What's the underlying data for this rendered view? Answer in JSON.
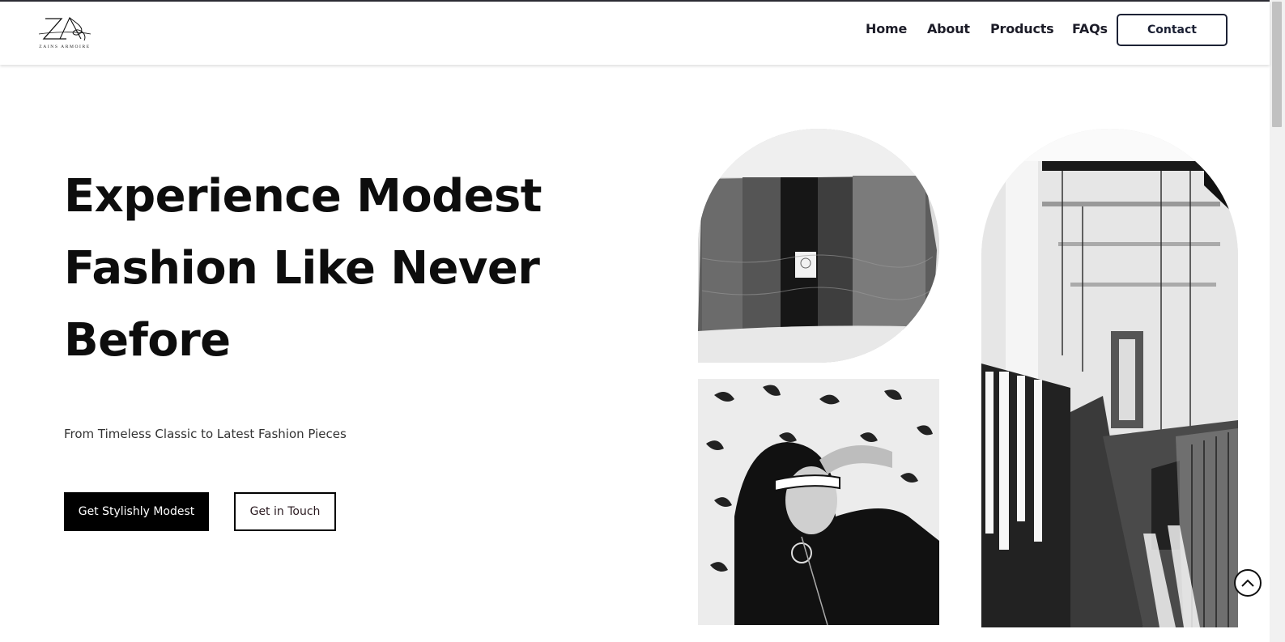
{
  "header": {
    "logo_text": "ZAINS ARMOIRE",
    "nav": [
      "Home",
      "About",
      "Products",
      "FAQs"
    ],
    "contact_label": "Contact"
  },
  "hero": {
    "title_lines": [
      "Experience Modest",
      "Fashion Like Never",
      "Before"
    ],
    "subtitle": "From Timeless Classic to Latest Fashion Pieces",
    "primary_button": "Get Stylishly Modest",
    "secondary_button": "Get in Touch"
  },
  "images": {
    "fabric": "fabric-photo",
    "woman": "woman-sunglasses-photo",
    "store": "boutique-interior-photo"
  },
  "icons": {
    "scroll_top": "chevron-up-icon"
  }
}
